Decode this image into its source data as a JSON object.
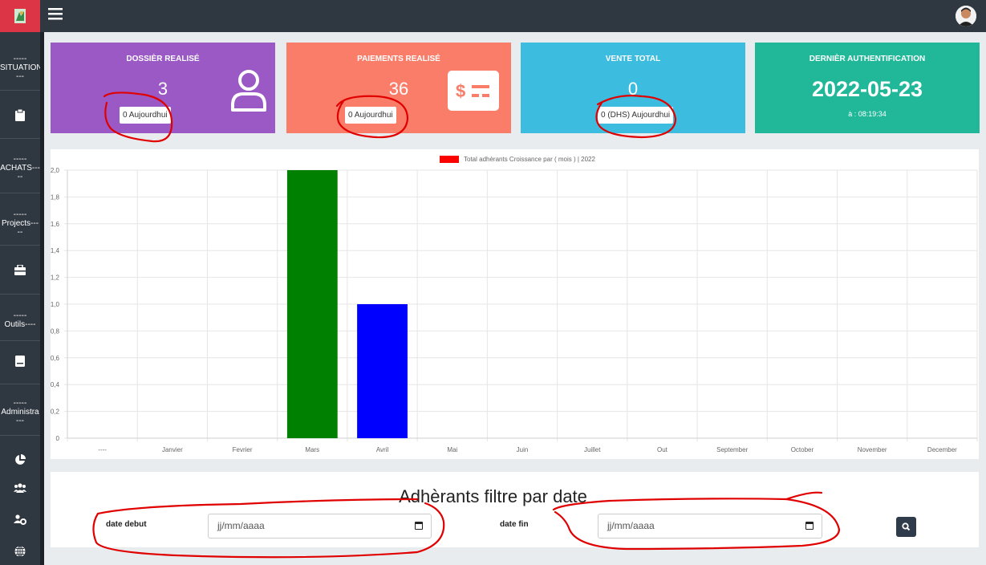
{
  "colors": {
    "topbar": "#2f3740",
    "card_dossier": "#9b59c6",
    "card_paiements": "#fa7d6a",
    "card_vente": "#3cbcde",
    "card_auth": "#21b89a",
    "bar_mars": "#008000",
    "bar_avril": "#0000ff",
    "legend_swatch": "#ff0000",
    "annotation": "#e00000"
  },
  "topbar": {
    "menu_icon": "hamburger-icon",
    "avatar": "user-avatar"
  },
  "sidebar": {
    "items": [
      {
        "label": "-----\nSITUATION\n---",
        "type": "section"
      },
      {
        "icon": "clipboard-icon",
        "type": "icon"
      },
      {
        "label": "-----\nACHATS---\n--",
        "type": "section"
      },
      {
        "label": "-----\nProjects---\n--",
        "type": "section"
      },
      {
        "icon": "toolbox-icon",
        "type": "icon"
      },
      {
        "label": "-----\nOutils----",
        "type": "section"
      },
      {
        "icon": "book-icon",
        "type": "icon"
      },
      {
        "label": "-----\nAdministra\n---",
        "type": "section"
      },
      {
        "icon": "pie-chart-icon",
        "type": "icon"
      },
      {
        "icon": "users-icon",
        "type": "icon"
      },
      {
        "icon": "users-cog-icon",
        "type": "icon"
      },
      {
        "icon": "globe-icon",
        "type": "icon"
      }
    ]
  },
  "cards": {
    "dossier": {
      "title": "DOSSIÈR REALISÉ",
      "value": "3",
      "today": "0 Aujourdhui",
      "icon": "user-icon"
    },
    "paiements": {
      "title": "PAIEMENTS REALISÉ",
      "value": "36",
      "today": "0 Aujourdhui",
      "icon": "money-bill-icon"
    },
    "vente": {
      "title": "VENTE TOTAL",
      "value": "0",
      "today": "0 (DHS) Aujourdhui"
    },
    "auth": {
      "title": "DERNIÈR AUTHENTIFICATION",
      "date": "2022-05-23",
      "time": "à : 08:19:34"
    }
  },
  "chart_data": {
    "type": "bar",
    "title": "",
    "legend": "Total adhèrants Croissance par ( mois ) | 2022",
    "legend_position": "top-center",
    "categories": [
      "----",
      "Janvier",
      "Fevrier",
      "Mars",
      "Avril",
      "Mai",
      "Juin",
      "Juillet",
      "Out",
      "September",
      "October",
      "November",
      "December"
    ],
    "values": [
      0,
      0,
      0,
      2,
      1,
      0,
      0,
      0,
      0,
      0,
      0,
      0,
      0
    ],
    "bar_colors": [
      "#008000",
      "#008000",
      "#008000",
      "#008000",
      "#0000ff",
      "#008000",
      "#008000",
      "#008000",
      "#008000",
      "#008000",
      "#008000",
      "#008000",
      "#008000"
    ],
    "ylim": [
      0,
      2
    ],
    "yticks": [
      "0",
      "0,2",
      "0,4",
      "0,6",
      "0,8",
      "1,0",
      "1,2",
      "1,4",
      "1,6",
      "1,8",
      "2,0"
    ],
    "grid": true,
    "xlabel": "",
    "ylabel": ""
  },
  "filter": {
    "title": "Adhèrants filtre par date",
    "start_label": "date debut",
    "start_placeholder": "jj/mm/aaaa",
    "end_label": "date fin",
    "end_placeholder": "jj/mm/aaaa",
    "search_icon": "search-icon"
  }
}
